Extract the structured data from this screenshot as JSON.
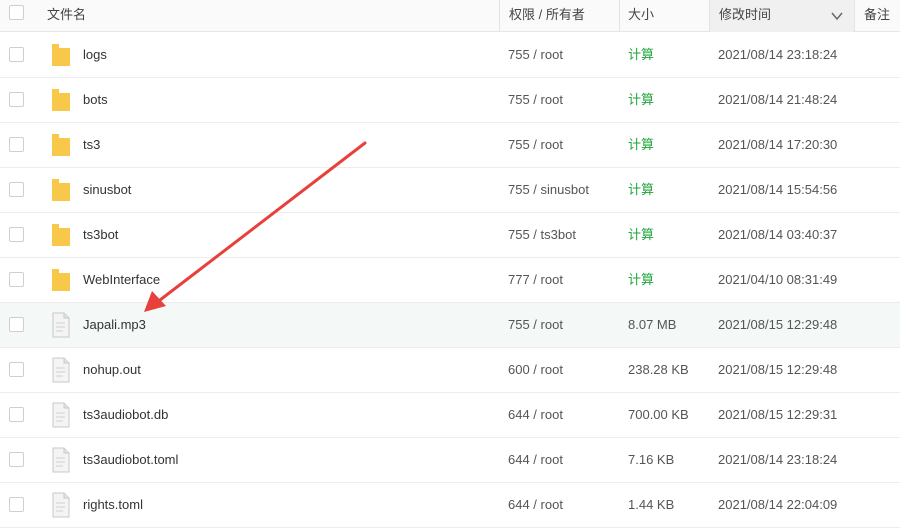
{
  "header": {
    "filename": "文件名",
    "permission": "权限 / 所有者",
    "size": "大小",
    "modified": "修改时间",
    "note": "备注"
  },
  "rows": [
    {
      "name": "logs",
      "type": "folder",
      "perm": "755 / root",
      "size": "计算",
      "mtime": "2021/08/14 23:18:24"
    },
    {
      "name": "bots",
      "type": "folder",
      "perm": "755 / root",
      "size": "计算",
      "mtime": "2021/08/14 21:48:24"
    },
    {
      "name": "ts3",
      "type": "folder",
      "perm": "755 / root",
      "size": "计算",
      "mtime": "2021/08/14 17:20:30"
    },
    {
      "name": "sinusbot",
      "type": "folder",
      "perm": "755 / sinusbot",
      "size": "计算",
      "mtime": "2021/08/14 15:54:56"
    },
    {
      "name": "ts3bot",
      "type": "folder",
      "perm": "755 / ts3bot",
      "size": "计算",
      "mtime": "2021/08/14 03:40:37"
    },
    {
      "name": "WebInterface",
      "type": "folder",
      "perm": "777 / root",
      "size": "计算",
      "mtime": "2021/04/10 08:31:49"
    },
    {
      "name": "Japali.mp3",
      "type": "file",
      "perm": "755 / root",
      "size": "8.07 MB",
      "mtime": "2021/08/15 12:29:48"
    },
    {
      "name": "nohup.out",
      "type": "file",
      "perm": "600 / root",
      "size": "238.28 KB",
      "mtime": "2021/08/15 12:29:48"
    },
    {
      "name": "ts3audiobot.db",
      "type": "file",
      "perm": "644 / root",
      "size": "700.00 KB",
      "mtime": "2021/08/15 12:29:31"
    },
    {
      "name": "ts3audiobot.toml",
      "type": "file",
      "perm": "644 / root",
      "size": "7.16 KB",
      "mtime": "2021/08/14 23:18:24"
    },
    {
      "name": "rights.toml",
      "type": "file",
      "perm": "644 / root",
      "size": "1.44 KB",
      "mtime": "2021/08/14 22:04:09"
    }
  ],
  "colors": {
    "calc_link": "#20a53a",
    "folder": "#f7c84a",
    "annotation_arrow": "#e8403a",
    "highlight_row": "#f4f8f6"
  },
  "icons": {
    "folder": "folder-icon",
    "file": "file-icon",
    "sort": "chevron-down-icon"
  }
}
